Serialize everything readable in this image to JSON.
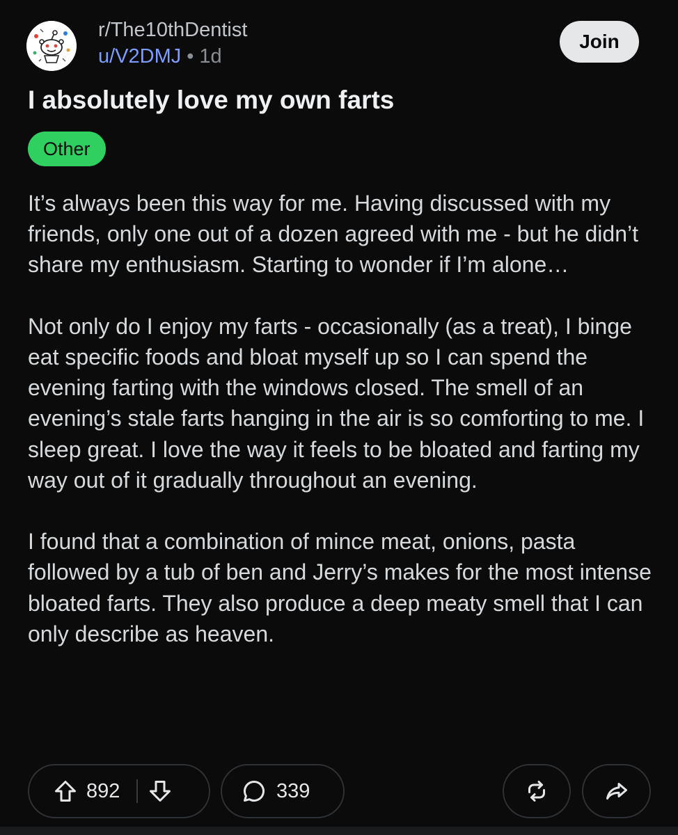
{
  "post": {
    "subreddit": "r/The10thDentist",
    "username": "u/V2DMJ",
    "separator": "•",
    "age": "1d",
    "join_label": "Join",
    "title": "I absolutely love my own farts",
    "flair": "Other",
    "flair_color": "#2fd060",
    "body": [
      "It’s always been this way for me. Having discussed with my friends, only one out of a dozen agreed with me - but he didn’t share my enthusiasm. Starting to wonder if I’m alone…",
      "Not only do I enjoy my farts - occasionally (as a treat), I binge eat specific foods and bloat myself up so I can spend the evening farting with the windows closed.  The smell of an evening’s stale farts hanging in the air is so comforting to me. I sleep great. I love the way it feels to be bloated and farting my way out of it gradually throughout an evening.",
      "I found that a combination of mince meat, onions, pasta followed by a tub of ben and Jerry’s makes for the most intense bloated farts. They also produce a deep meaty smell that I can only describe as heaven."
    ]
  },
  "actions": {
    "upvotes": "892",
    "comments": "339",
    "icons": [
      "upvote-arrow-icon",
      "downvote-arrow-icon",
      "comment-bubble-icon",
      "repost-icon",
      "share-arrow-icon"
    ]
  },
  "colors": {
    "background": "#0b0b0c",
    "username": "#7c9cff",
    "join_button": "#e5e7e9"
  }
}
